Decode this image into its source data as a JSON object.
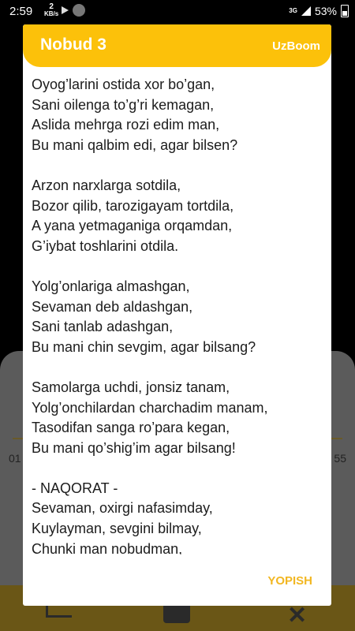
{
  "status_bar": {
    "time": "2:59",
    "net_speed": "2",
    "net_unit": "KB/s",
    "network": "3G",
    "battery": "53%"
  },
  "background_player": {
    "time_left": "01",
    "time_right": "55"
  },
  "dialog": {
    "title": "Nobud 3",
    "brand": "UzBoom",
    "lyrics": "Oyog’larini ostida xor bo’gan,\nSani oilenga to’g’ri kemagan,\nAslida mehrga rozi edim man,\nBu mani qalbim edi, agar bilsen?\n\nArzon narxlarga sotdila,\nBozor qilib, tarozigayam tortdila,\nA yana yetmaganiga orqamdan,\nG’iybat toshlarini otdila.\n\nYolg’onlariga almashgan,\nSevaman deb aldashgan,\nSani tanlab adashgan,\nBu mani chin sevgim, agar bilsang?\n\nSamolarga uchdi, jonsiz tanam,\nYolg’onchilardan charchadim manam,\nTasodifan sanga ro’para kegan,\nBu mani qo’shig’im agar bilsang!\n\n- NAQORAT -\nSevaman, oxirgi nafasimday,\nKuylayman, sevgini bilmay,\nChunki man nobudman,",
    "close_label": "YOPISH"
  }
}
